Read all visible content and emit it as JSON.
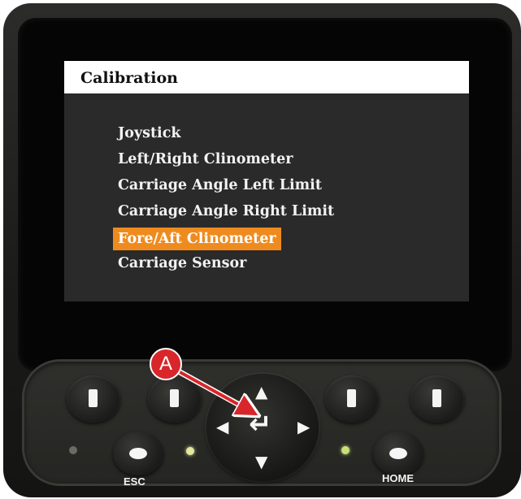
{
  "screen": {
    "title": "Calibration",
    "menu": [
      {
        "label": "Joystick",
        "selected": false
      },
      {
        "label": "Left/Right Clinometer",
        "selected": false
      },
      {
        "label": "Carriage Angle Left Limit",
        "selected": false
      },
      {
        "label": "Carriage Angle Right Limit",
        "selected": false
      },
      {
        "label": "Fore/Aft Clinometer",
        "selected": true
      },
      {
        "label": "Carriage Sensor",
        "selected": false
      }
    ]
  },
  "keypad": {
    "esc_label": "ESC",
    "home_label": "HOME",
    "enter_icon": "enter-icon",
    "arrows": [
      "arrow-up-icon",
      "arrow-down-icon",
      "arrow-left-icon",
      "arrow-right-icon"
    ]
  },
  "callout": {
    "label": "A",
    "color": "#d8262a"
  },
  "colors": {
    "highlight": "#ef8b1e",
    "led_left": "#6b6b62",
    "led_green": "#c8e07a",
    "led_yellow": "#e3e7a0"
  }
}
